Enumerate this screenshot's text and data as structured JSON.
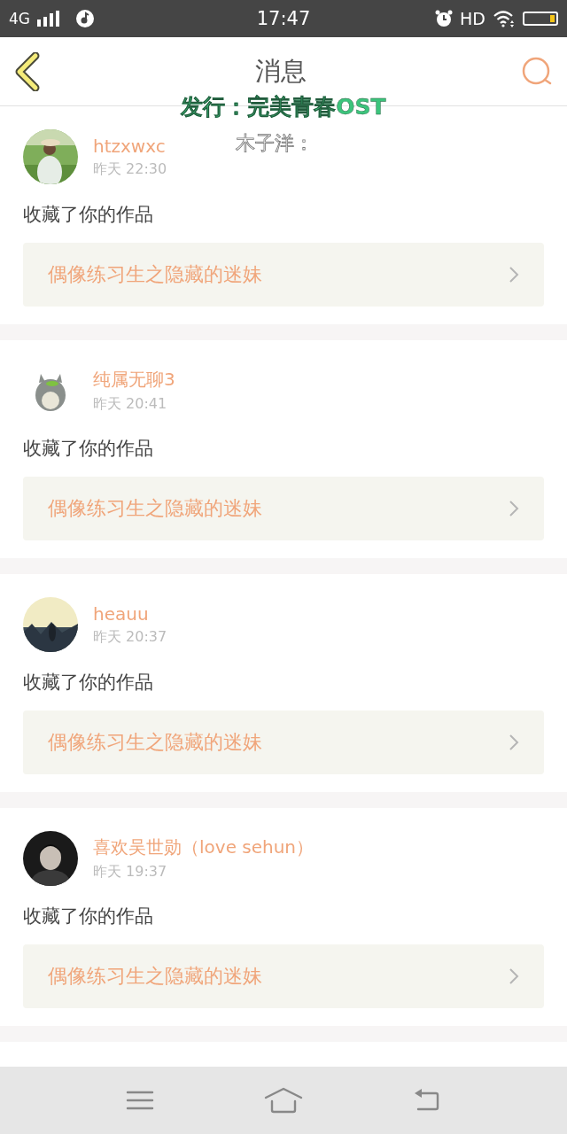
{
  "status_bar": {
    "network": "4G",
    "time": "17:47",
    "hd": "HD",
    "battery": {
      "level": 0.15
    }
  },
  "header": {
    "title": "消息"
  },
  "lyrics_overlay": {
    "line_1": "发行：完美青春OST",
    "line_2": "木子洋："
  },
  "messages": [
    {
      "user": "htzxwxc",
      "time": "昨天 22:30",
      "action": "收藏了你的作品",
      "work": "偶像练习生之隐藏的迷妹"
    },
    {
      "user": "纯属无聊3",
      "time": "昨天 20:41",
      "action": "收藏了你的作品",
      "work": "偶像练习生之隐藏的迷妹"
    },
    {
      "user": "heauu",
      "time": "昨天 20:37",
      "action": "收藏了你的作品",
      "work": "偶像练习生之隐藏的迷妹"
    },
    {
      "user": "喜欢吴世勋（love sehun）",
      "time": "昨天 19:37",
      "action": "收藏了你的作品",
      "work": "偶像练习生之隐藏的迷妹"
    }
  ]
}
